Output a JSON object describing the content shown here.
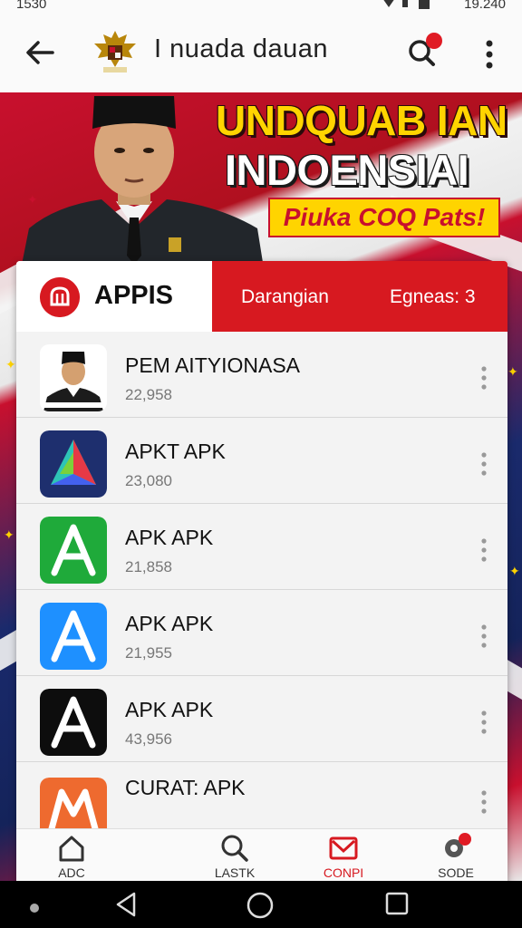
{
  "status_bar": {
    "time_left": "1530",
    "time_right": "19.240"
  },
  "app_bar": {
    "title": "I nuada dauan"
  },
  "hero": {
    "headline_1": "UNDQUAB IAN",
    "headline_2": "INDOENSIAI",
    "promo": "Piuka COQ Pats!"
  },
  "card": {
    "apps_tab": "APPIS",
    "tabs": [
      "Darangian",
      "Egneas: 3"
    ]
  },
  "apps": [
    {
      "name": "PEM AITYIONASA",
      "count": "22,958",
      "icon": "person-portrait"
    },
    {
      "name": "APKT APK",
      "count": "23,080",
      "icon": "colorful-triangle"
    },
    {
      "name": "APK APK",
      "count": "21,858",
      "icon": "green-a"
    },
    {
      "name": "APK APK",
      "count": "21,955",
      "icon": "blue-a"
    },
    {
      "name": "APK APK",
      "count": "43,956",
      "icon": "black-a"
    },
    {
      "name": "CURAT: APK",
      "count": "",
      "icon": "orange-m"
    }
  ],
  "bottom_nav": [
    {
      "label": "ADC",
      "icon": "home-icon"
    },
    {
      "label": "LASTK",
      "icon": "search-icon"
    },
    {
      "label": "CONPI",
      "icon": "mail-icon",
      "active": true
    },
    {
      "label": "SODE",
      "icon": "settings-icon"
    }
  ],
  "colors": {
    "brand_red": "#d71920",
    "yellow": "#ffd400",
    "navy": "#1a2a6c"
  }
}
